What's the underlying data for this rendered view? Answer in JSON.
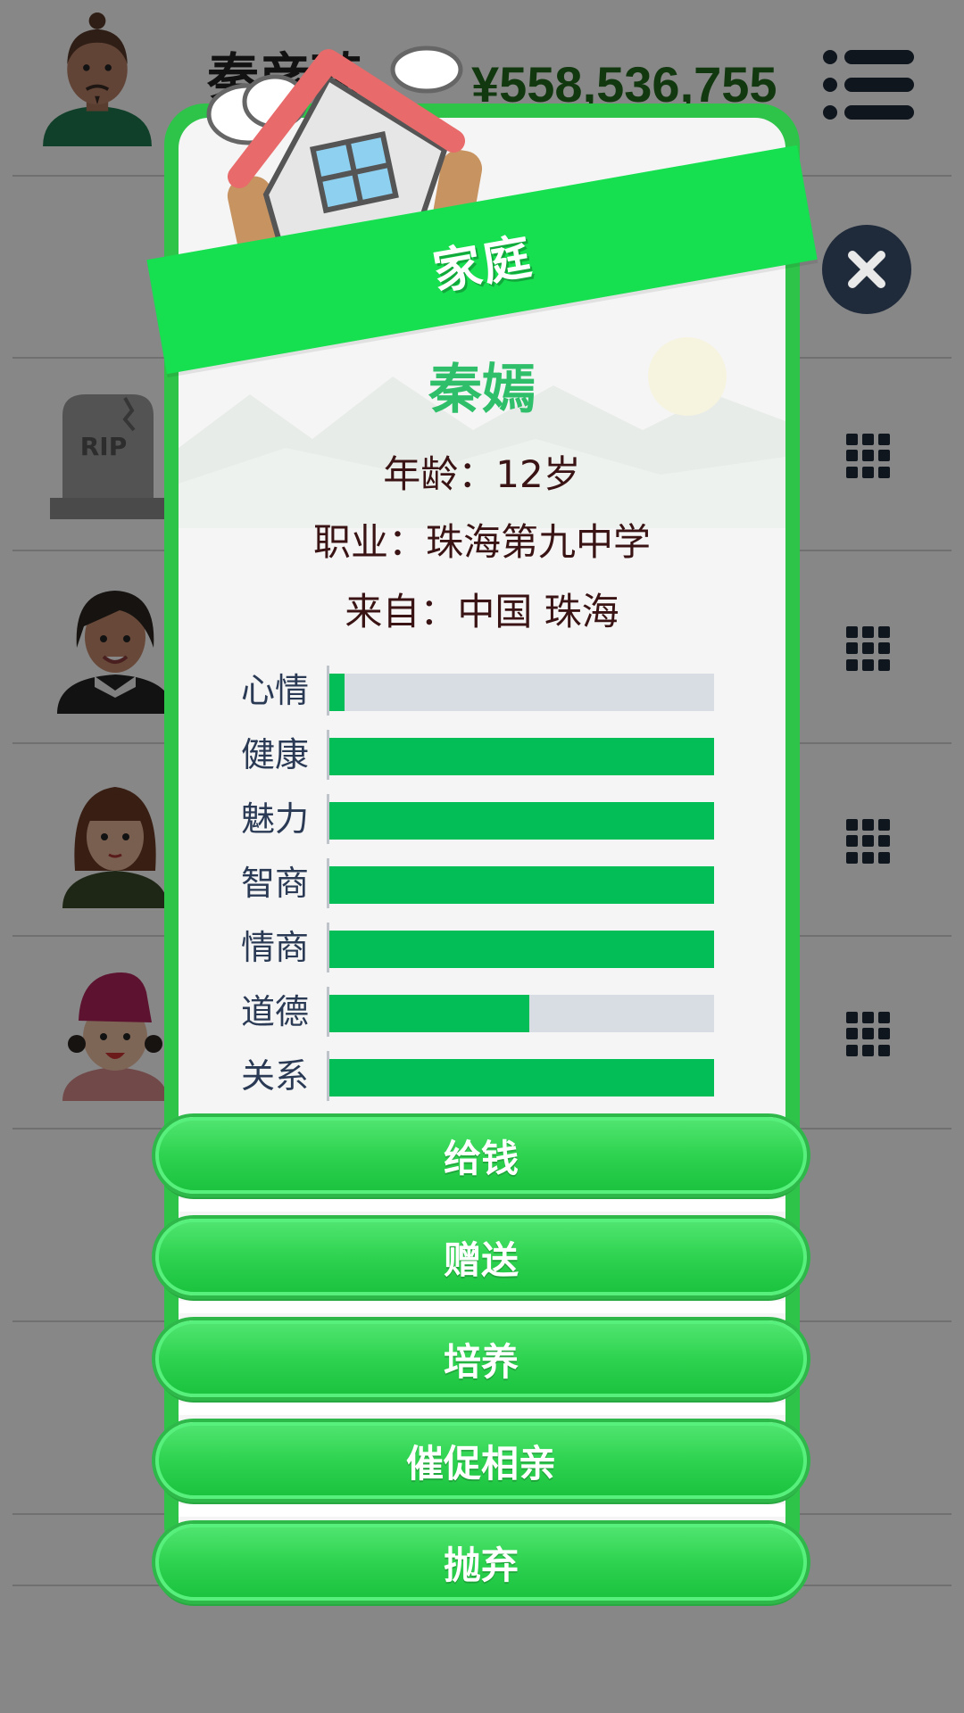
{
  "header": {
    "player_name": "秦彦琦",
    "money": "¥558,536,755"
  },
  "background_list": {
    "tombstone_text": "RIP"
  },
  "dialog": {
    "title": "家庭",
    "member_name": "秦嫣",
    "age_line": "年龄：12岁",
    "job_line": "职业：珠海第九中学",
    "from_line": "来自：中国 珠海",
    "stats": [
      {
        "label": "心情",
        "value": 0.04
      },
      {
        "label": "健康",
        "value": 1.0
      },
      {
        "label": "魅力",
        "value": 1.0
      },
      {
        "label": "智商",
        "value": 1.0
      },
      {
        "label": "情商",
        "value": 1.0
      },
      {
        "label": "道德",
        "value": 0.52
      },
      {
        "label": "关系",
        "value": 1.0
      }
    ],
    "actions": [
      {
        "label": "给钱"
      },
      {
        "label": "赠送"
      },
      {
        "label": "培养"
      },
      {
        "label": "催促相亲"
      },
      {
        "label": "抛弃"
      }
    ]
  },
  "colors": {
    "dialog_border": "#2ec44a",
    "ribbon": "#17e050",
    "bar_fill": "#03bd57",
    "bar_track": "#d8dde4",
    "name": "#2fbf6a"
  },
  "icons": {
    "menu": "menu-icon",
    "close": "close-icon",
    "row_menu": "grid-menu-icon"
  }
}
